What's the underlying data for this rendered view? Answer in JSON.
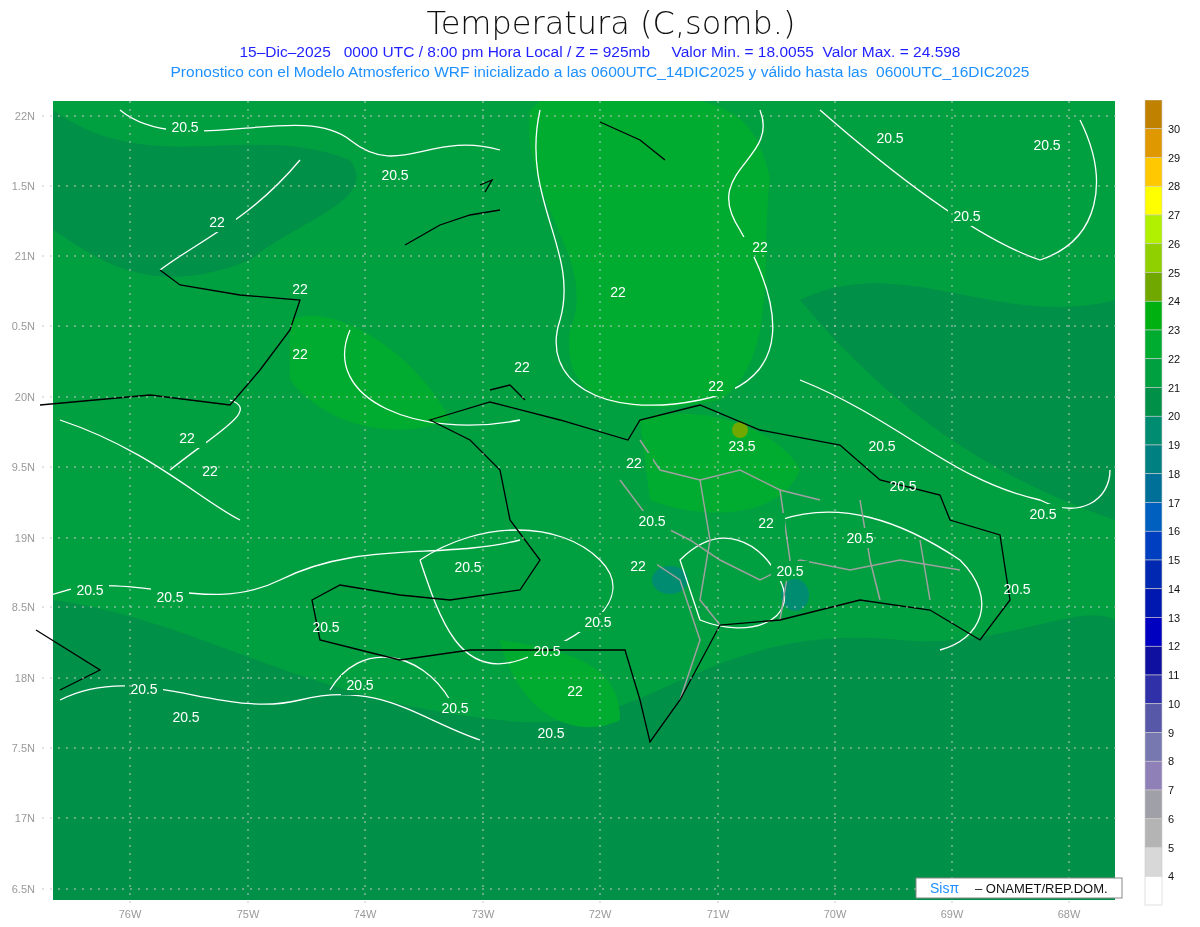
{
  "title": "Temperatura (C,somb.)",
  "subtitle": "15–Dic–2025   0000 UTC / 8:00 pm Hora Local / Z = 925mb     Valor Min. = 18.0055  Valor Max. = 24.598",
  "model_note": "Pronostico con el Modelo Atmosferico WRF inicializado a las 0600UTC_14DIC2025 y válido hasta las  0600UTC_16DIC2025",
  "y_axis": [
    "22N",
    "1.5N",
    "21N",
    "0.5N",
    "20N",
    "9.5N",
    "19N",
    "8.5N",
    "18N",
    "7.5N",
    "17N",
    "6.5N"
  ],
  "x_axis": [
    "76W",
    "75W",
    "74W",
    "73W",
    "72W",
    "71W",
    "70W",
    "69W",
    "68W"
  ],
  "contour_labels": [
    "20.5",
    "20.5",
    "20.5",
    "20.5",
    "20.5",
    "22",
    "22",
    "22",
    "22",
    "22",
    "22",
    "22",
    "22",
    "22",
    "23.5",
    "22",
    "20.5",
    "20.5",
    "20.5",
    "20.5",
    "22",
    "20.5",
    "20.5",
    "22",
    "20.5",
    "20.5",
    "20.5",
    "20.5",
    "20.5",
    "20.5",
    "20.5",
    "20.5",
    "20.5",
    "22",
    "20.5",
    "20.5",
    "20.5"
  ],
  "credit": {
    "brand": "Sisπ",
    "text": "– ONAMET/REP.DOM."
  },
  "legend": {
    "colors": [
      {
        "color": "#c08000"
      },
      {
        "color": "#e09800"
      },
      {
        "color": "#ffc800"
      },
      {
        "color": "#ffff00"
      },
      {
        "color": "#b0f000"
      },
      {
        "color": "#90d000"
      },
      {
        "color": "#70a800"
      },
      {
        "color": "#00b010"
      },
      {
        "color": "#00ac30"
      },
      {
        "color": "#00a040"
      },
      {
        "color": "#009048"
      },
      {
        "color": "#008c70"
      },
      {
        "color": "#008080"
      },
      {
        "color": "#007098"
      },
      {
        "color": "#0060c0"
      },
      {
        "color": "#0040c0"
      },
      {
        "color": "#0028b0"
      },
      {
        "color": "#0018b0"
      },
      {
        "color": "#0000c0"
      },
      {
        "color": "#1010a0"
      },
      {
        "color": "#3030a8"
      },
      {
        "color": "#5858a8"
      },
      {
        "color": "#7878b0"
      },
      {
        "color": "#9080b8"
      },
      {
        "color": "#a0a0a8"
      },
      {
        "color": "#b4b4b4"
      },
      {
        "color": "#d8d8d8"
      },
      {
        "color": "#ffffff"
      }
    ],
    "labels": [
      "30",
      "29",
      "28",
      "27",
      "26",
      "25",
      "24",
      "23",
      "22",
      "21",
      "20",
      "19",
      "18",
      "17",
      "16",
      "15",
      "14",
      "13",
      "12",
      "11",
      "10",
      "9",
      "8",
      "7",
      "6",
      "5",
      "4"
    ]
  }
}
